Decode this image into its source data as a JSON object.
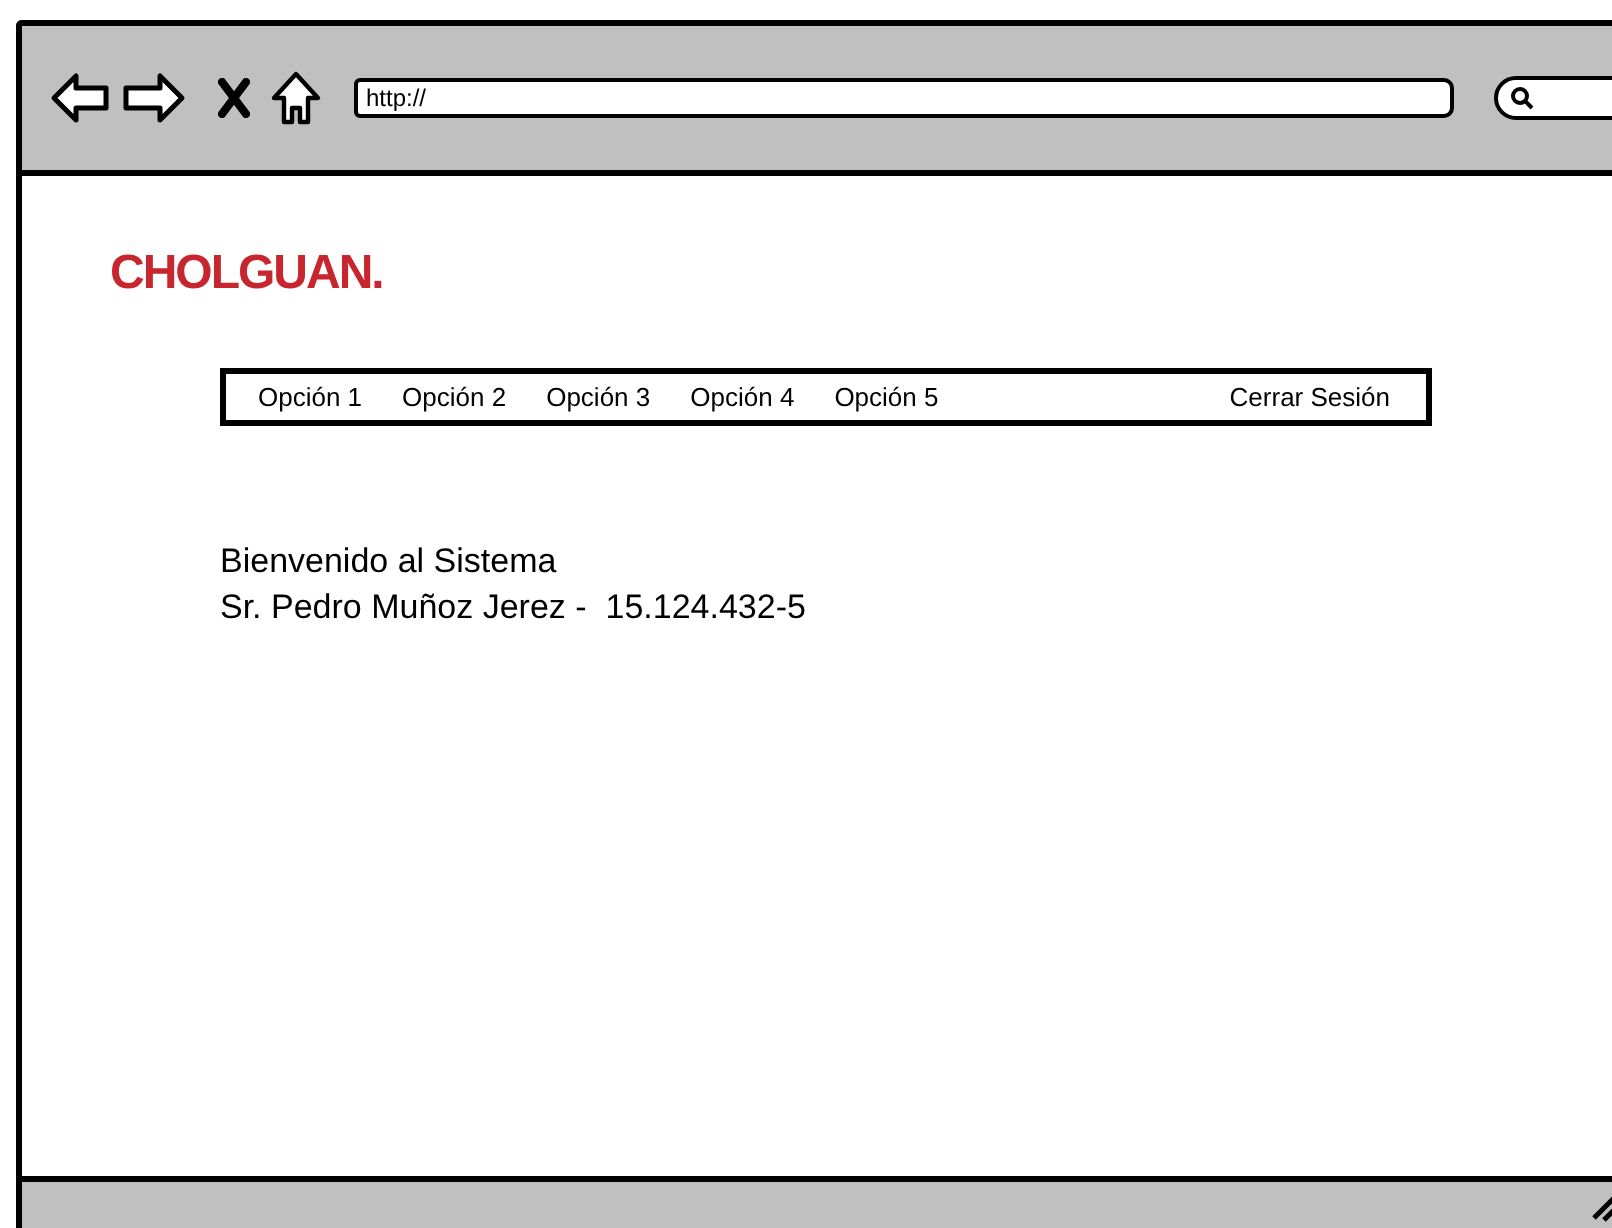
{
  "browser": {
    "address": "http://"
  },
  "logo": "CHOLGUAN.",
  "menu": {
    "items": [
      {
        "label": "Opción 1"
      },
      {
        "label": "Opción 2"
      },
      {
        "label": "Opción 3"
      },
      {
        "label": "Opción 4"
      },
      {
        "label": "Opción 5"
      }
    ],
    "logout": "Cerrar Sesión"
  },
  "welcome": {
    "title": "Bienvenido al Sistema",
    "user": "Sr. Pedro Muñoz Jerez -  15.124.432-5"
  }
}
